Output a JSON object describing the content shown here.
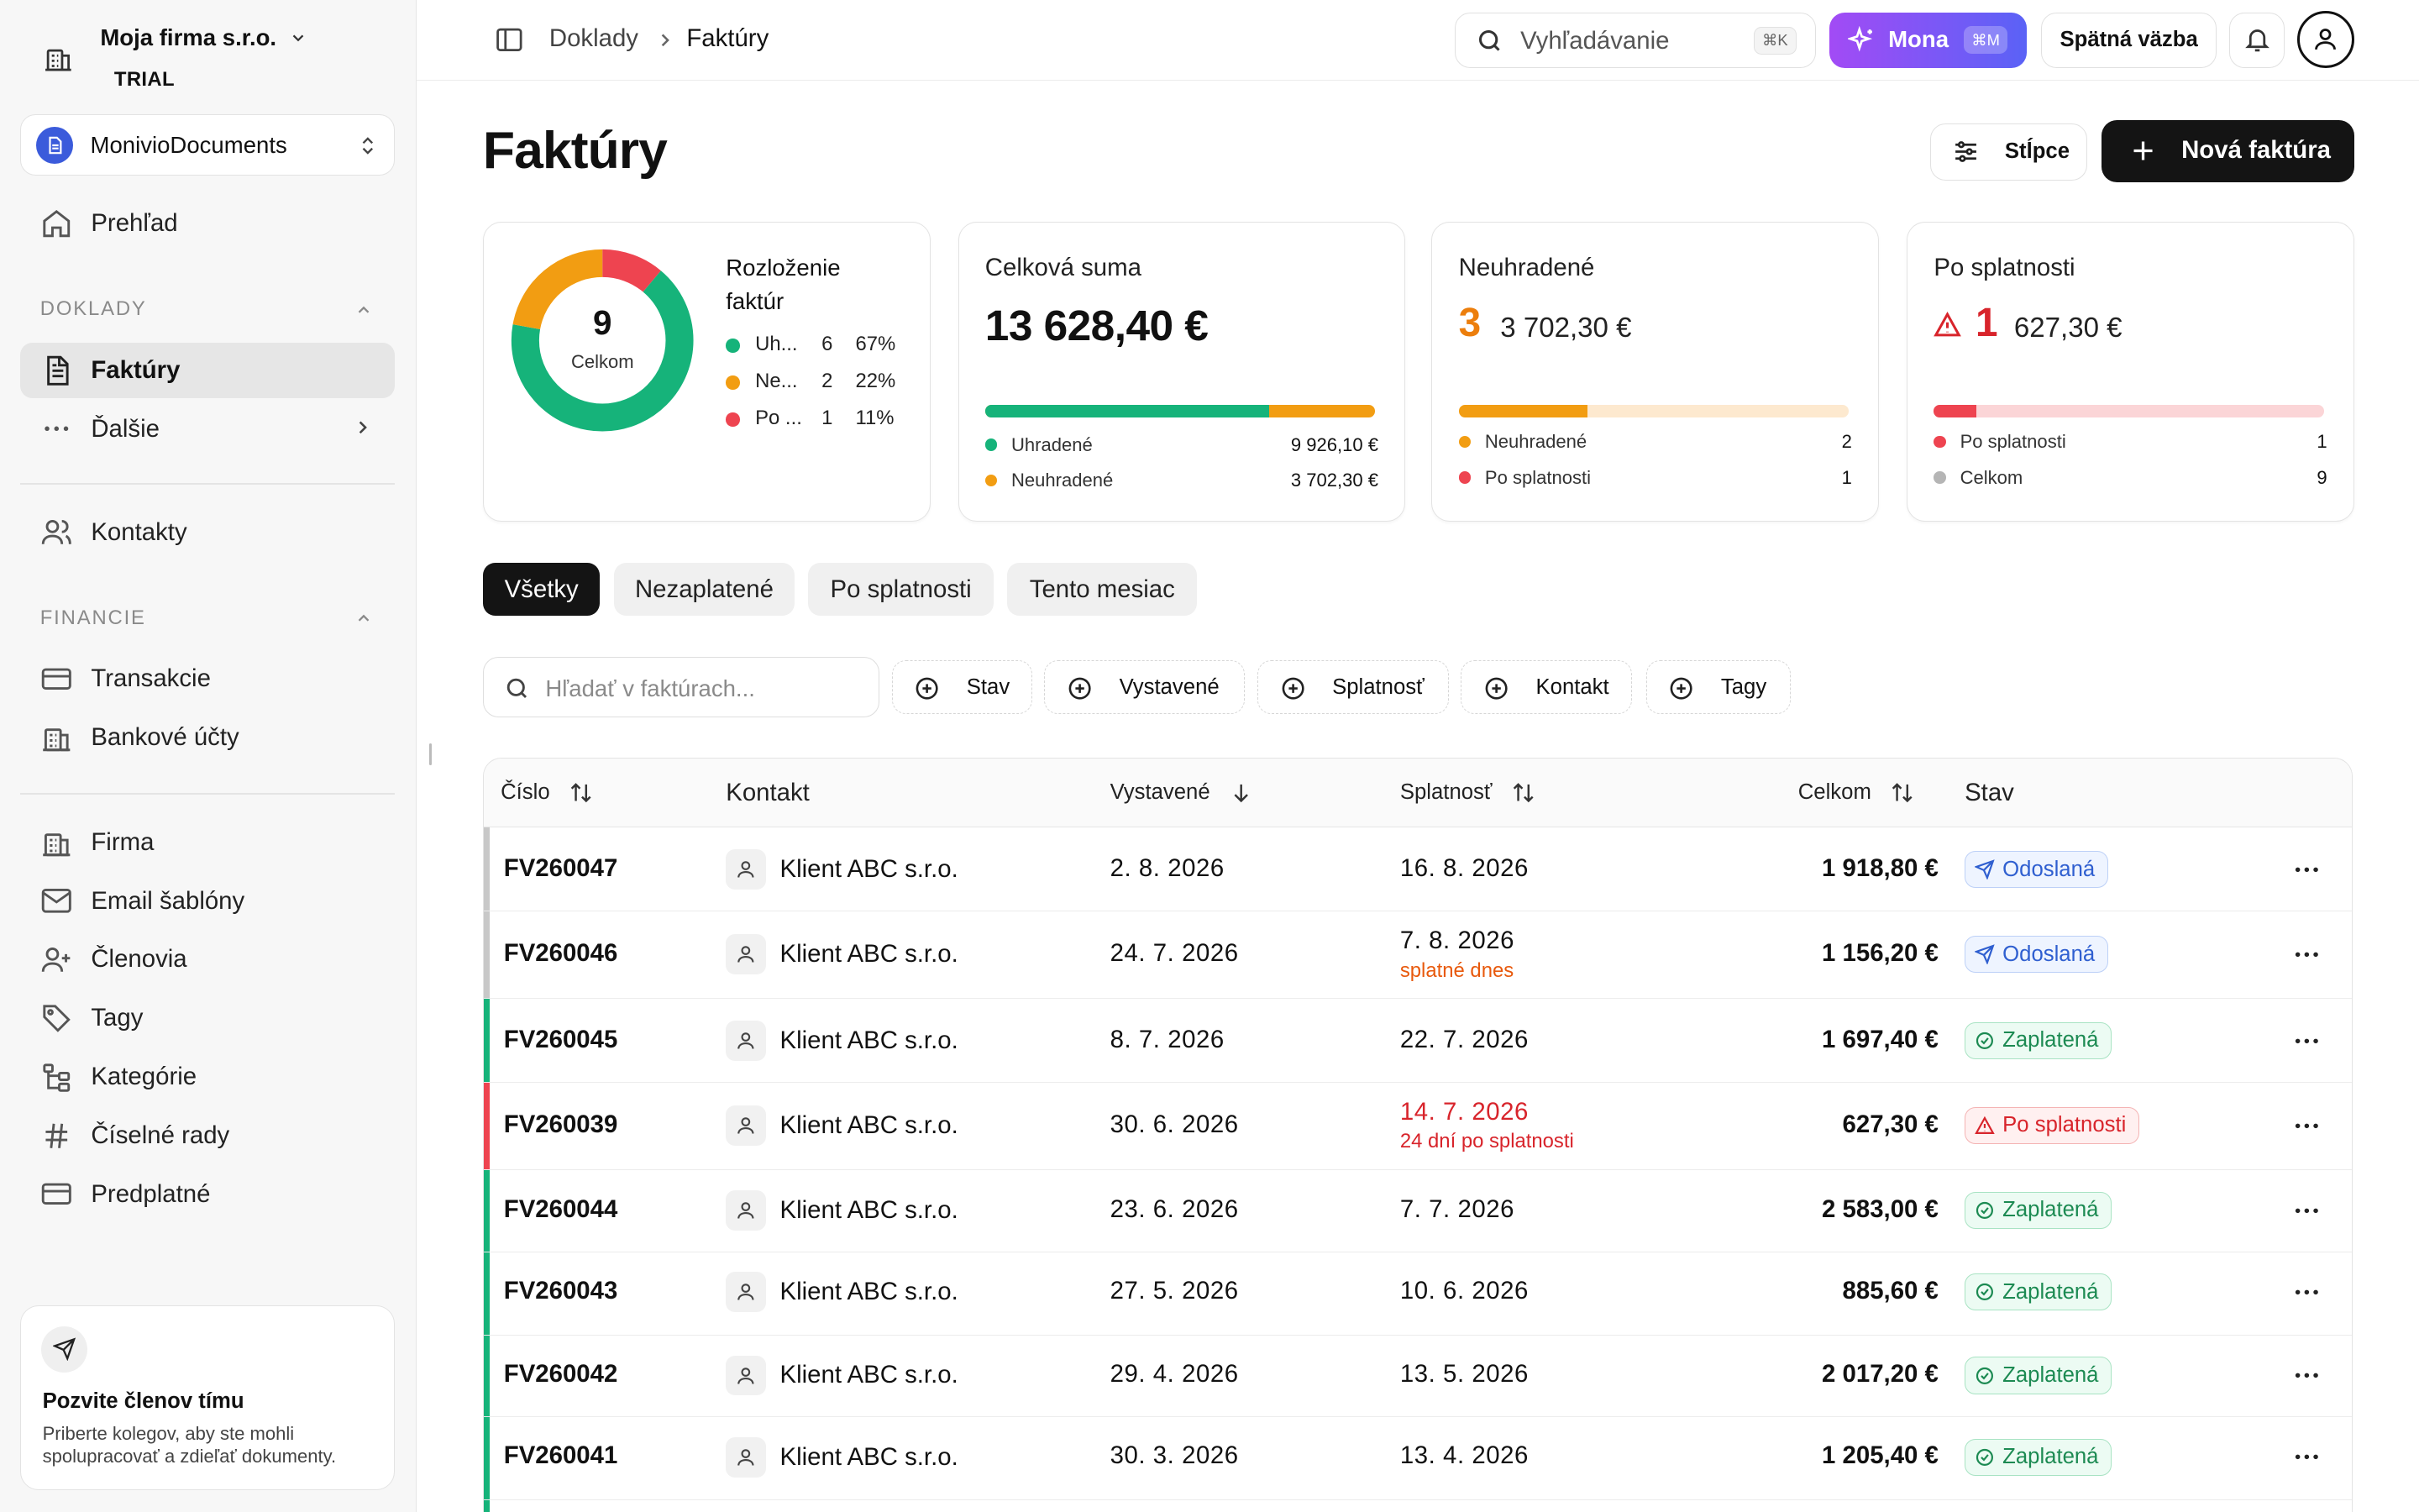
{
  "sidebar": {
    "company_name": "Moja firma s.r.o.",
    "plan": "TRIAL",
    "workspace": "MonivioDocuments",
    "overview": "Prehľad",
    "section_doklady": "DOKLADY",
    "invoices": "Faktúry",
    "more": "Ďalšie",
    "contacts": "Kontakty",
    "section_finance": "FINANCIE",
    "transactions": "Transakcie",
    "bank_accounts": "Bankové účty",
    "company": "Firma",
    "email_templates": "Email šablóny",
    "members": "Členovia",
    "tags": "Tagy",
    "categories": "Kategórie",
    "number_series": "Číselné rady",
    "subscription": "Predplatné",
    "invite_title": "Pozvite členov tímu",
    "invite_desc": "Priberte kolegov, aby ste mohli spolupracovať a zdieľať dokumenty."
  },
  "topbar": {
    "crumb_parent": "Doklady",
    "crumb_current": "Faktúry",
    "search_placeholder": "Vyhľadávanie",
    "search_kbd": "⌘K",
    "mona_label": "Mona",
    "mona_kbd": "⌘M",
    "feedback": "Spätná väzba"
  },
  "header": {
    "title": "Faktúry",
    "columns_button": "Stĺpce",
    "new_invoice_button": "Nová faktúra"
  },
  "cards": {
    "distribution": {
      "total": "9",
      "total_label": "Celkom",
      "title": "Rozloženie faktúr",
      "legend": [
        {
          "name": "Uh...",
          "count": "6",
          "pct": "67%",
          "color": "#16b37a",
          "fraction": 0.6667
        },
        {
          "name": "Ne...",
          "count": "2",
          "pct": "22%",
          "color": "#f29d12",
          "fraction": 0.2222
        },
        {
          "name": "Po ...",
          "count": "1",
          "pct": "11%",
          "color": "#ee4450",
          "fraction": 0.1111
        }
      ]
    },
    "total_sum": {
      "title": "Celková suma",
      "amount": "13 628,40 €",
      "paid_label": "Uhradené",
      "paid_value": "9 926,10 €",
      "unpaid_label": "Neuhradené",
      "unpaid_value": "3 702,30 €",
      "paid_fraction": 0.728
    },
    "unpaid": {
      "title": "Neuhradené",
      "count": "3",
      "amount": "3 702,30 €",
      "row1_label": "Neuhradené",
      "row1_value": "2",
      "row2_label": "Po splatnosti",
      "row2_value": "1",
      "fill_fraction": 0.33
    },
    "overdue": {
      "title": "Po splatnosti",
      "count": "1",
      "amount": "627,30 €",
      "row1_label": "Po splatnosti",
      "row1_value": "1",
      "row2_label": "Celkom",
      "row2_value": "9",
      "fill_fraction": 0.11
    }
  },
  "tabs": [
    "Všetky",
    "Nezaplatené",
    "Po splatnosti",
    "Tento mesiac"
  ],
  "filters": {
    "search_placeholder": "Hľadať v faktúrach...",
    "buttons": [
      "Stav",
      "Vystavené",
      "Splatnosť",
      "Kontakt",
      "Tagy"
    ]
  },
  "table": {
    "headers": {
      "number": "Číslo",
      "contact": "Kontakt",
      "issued": "Vystavené",
      "due": "Splatnosť",
      "total": "Celkom",
      "status": "Stav"
    },
    "rows": [
      {
        "number": "FV260047",
        "contact": "Klient ABC s.r.o.",
        "issued": "2. 8. 2026",
        "due": "16. 8. 2026",
        "due_note": "",
        "total": "1 918,80 €",
        "status": "Odoslaná",
        "status_type": "sent",
        "stripe": "#c8c8c8"
      },
      {
        "number": "FV260046",
        "contact": "Klient ABC s.r.o.",
        "issued": "24. 7. 2026",
        "due": "7. 8. 2026",
        "due_note": "splatné dnes",
        "total": "1 156,20 €",
        "status": "Odoslaná",
        "status_type": "sent",
        "stripe": "#c8c8c8"
      },
      {
        "number": "FV260045",
        "contact": "Klient ABC s.r.o.",
        "issued": "8. 7. 2026",
        "due": "22. 7. 2026",
        "due_note": "",
        "total": "1 697,40 €",
        "status": "Zaplatená",
        "status_type": "paid",
        "stripe": "#16b37a"
      },
      {
        "number": "FV260039",
        "contact": "Klient ABC s.r.o.",
        "issued": "30. 6. 2026",
        "due": "14. 7. 2026",
        "due_note": "24 dní po splatnosti",
        "total": "627,30 €",
        "status": "Po splatnosti",
        "status_type": "overdue",
        "stripe": "#ee4450"
      },
      {
        "number": "FV260044",
        "contact": "Klient ABC s.r.o.",
        "issued": "23. 6. 2026",
        "due": "7. 7. 2026",
        "due_note": "",
        "total": "2 583,00 €",
        "status": "Zaplatená",
        "status_type": "paid",
        "stripe": "#16b37a"
      },
      {
        "number": "FV260043",
        "contact": "Klient ABC s.r.o.",
        "issued": "27. 5. 2026",
        "due": "10. 6. 2026",
        "due_note": "",
        "total": "885,60 €",
        "status": "Zaplatená",
        "status_type": "paid",
        "stripe": "#16b37a"
      },
      {
        "number": "FV260042",
        "contact": "Klient ABC s.r.o.",
        "issued": "29. 4. 2026",
        "due": "13. 5. 2026",
        "due_note": "",
        "total": "2 017,20 €",
        "status": "Zaplatená",
        "status_type": "paid",
        "stripe": "#16b37a"
      },
      {
        "number": "FV260041",
        "contact": "Klient ABC s.r.o.",
        "issued": "30. 3. 2026",
        "due": "13. 4. 2026",
        "due_note": "",
        "total": "1 205,40 €",
        "status": "Zaplatená",
        "status_type": "paid",
        "stripe": "#16b37a"
      }
    ]
  },
  "colors": {
    "green": "#16b37a",
    "orange": "#f29d12",
    "red": "#ee4450",
    "dark": "#141414"
  }
}
